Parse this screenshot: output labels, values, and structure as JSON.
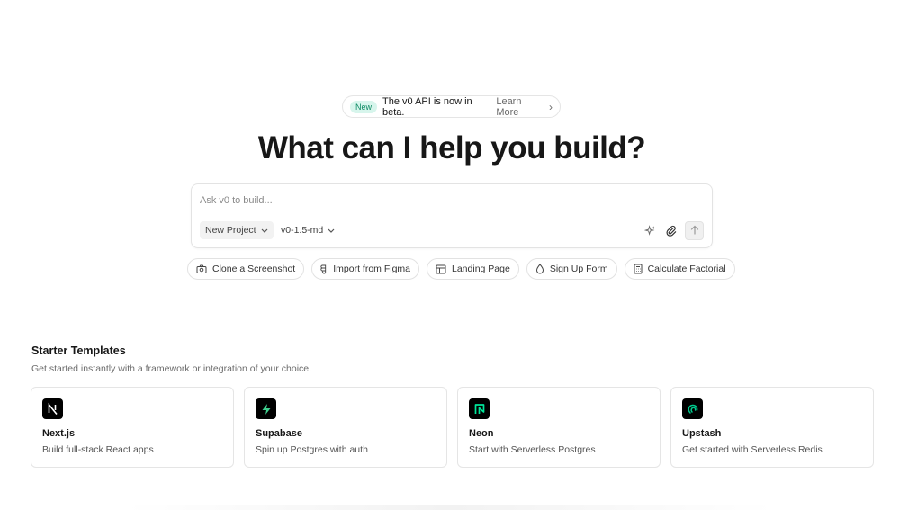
{
  "announcement": {
    "badge": "New",
    "text": "The v0 API is now in beta.",
    "link": "Learn More",
    "chevron": "›"
  },
  "headline": "What can I help you build?",
  "prompt": {
    "placeholder": "Ask v0 to build...",
    "value": "",
    "project_label": "New Project",
    "model_label": "v0-1.5-md",
    "icons": [
      "sparkles-icon",
      "paperclip-icon",
      "arrow-up-icon"
    ]
  },
  "suggestions": [
    {
      "label": "Clone a Screenshot",
      "icon": "camera-icon"
    },
    {
      "label": "Import from Figma",
      "icon": "figma-icon"
    },
    {
      "label": "Landing Page",
      "icon": "layout-icon"
    },
    {
      "label": "Sign Up Form",
      "icon": "droplet-icon"
    },
    {
      "label": "Calculate Factorial",
      "icon": "calculator-icon"
    }
  ],
  "starter": {
    "title": "Starter Templates",
    "subtitle": "Get started instantly with a framework or integration of your choice.",
    "cards": [
      {
        "title": "Next.js",
        "desc": "Build full-stack React apps",
        "icon": "nextjs-logo-icon"
      },
      {
        "title": "Supabase",
        "desc": "Spin up Postgres with auth",
        "icon": "supabase-logo-icon"
      },
      {
        "title": "Neon",
        "desc": "Start with Serverless Postgres",
        "icon": "neon-logo-icon"
      },
      {
        "title": "Upstash",
        "desc": "Get started with Serverless Redis",
        "icon": "upstash-logo-icon"
      }
    ]
  },
  "colors": {
    "badge_bg": "#d7f5ec",
    "badge_text": "#0d8a63",
    "supabase_green": "#3ecf8e",
    "neon_green": "#00e599",
    "upstash_green": "#00c98d"
  }
}
